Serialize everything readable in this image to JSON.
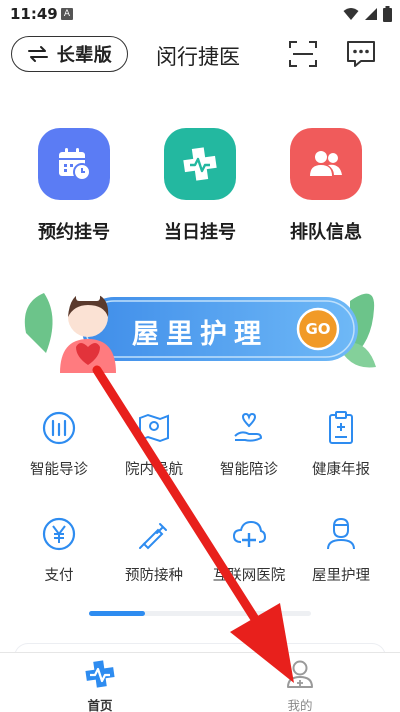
{
  "status_bar": {
    "time": "11:49",
    "notification_badge": "A",
    "icons": [
      "wifi-icon",
      "signal-icon",
      "battery-icon"
    ]
  },
  "header": {
    "elder_mode_label": "长辈版",
    "app_title": "闵行捷医",
    "scan_icon": "scan-icon",
    "message_icon": "message-icon"
  },
  "big_actions": [
    {
      "label": "预约挂号",
      "icon": "calendar-clock-icon",
      "color": "#5b7cf4"
    },
    {
      "label": "当日挂号",
      "icon": "medical-cross-icon",
      "color": "#23b8a0"
    },
    {
      "label": "排队信息",
      "icon": "people-icon",
      "color": "#f05b5b"
    }
  ],
  "banner": {
    "text": "屋里护理",
    "go_label": "GO"
  },
  "services": [
    {
      "label": "智能导诊",
      "icon": "guide-icon"
    },
    {
      "label": "院内导航",
      "icon": "navigation-icon"
    },
    {
      "label": "智能陪诊",
      "icon": "escort-icon"
    },
    {
      "label": "健康年报",
      "icon": "report-icon"
    },
    {
      "label": "支付",
      "icon": "payment-icon"
    },
    {
      "label": "预防接种",
      "icon": "vaccine-icon"
    },
    {
      "label": "互联网医院",
      "icon": "cloud-hospital-icon"
    },
    {
      "label": "屋里护理",
      "icon": "nurse-icon"
    }
  ],
  "pager": {
    "active_index": 0,
    "pages": 2
  },
  "bottom_nav": [
    {
      "label": "首页",
      "icon": "home-icon",
      "active": true
    },
    {
      "label": "我的",
      "icon": "profile-icon",
      "active": false
    }
  ],
  "colors": {
    "accent": "#2e8cf0",
    "arrow": "#e8201c"
  }
}
